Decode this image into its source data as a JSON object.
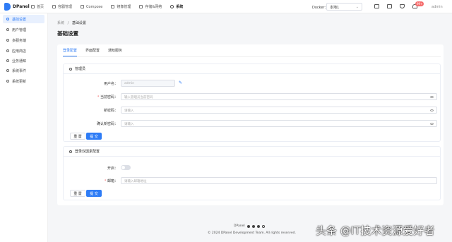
{
  "app": {
    "name": "DPanel"
  },
  "nav": {
    "items": [
      {
        "label": "首页",
        "icon": "home-icon"
      },
      {
        "label": "容器管理",
        "icon": "container-icon"
      },
      {
        "label": "Compose",
        "icon": "compose-icon"
      },
      {
        "label": "镜像管理",
        "icon": "image-icon"
      },
      {
        "label": "存储&网络",
        "icon": "storage-icon"
      },
      {
        "label": "系统",
        "icon": "gear-icon"
      }
    ],
    "active": "系统"
  },
  "docker": {
    "label": "Docker：",
    "value": "本地1"
  },
  "header": {
    "badge": "99+",
    "user": "admin"
  },
  "sidebar": {
    "items": [
      {
        "label": "基础设置"
      },
      {
        "label": "用户管理"
      },
      {
        "label": "多服务端"
      },
      {
        "label": "应用商店"
      },
      {
        "label": "业务通知"
      },
      {
        "label": "系统事件"
      },
      {
        "label": "系统更新"
      }
    ]
  },
  "breadcrumb": {
    "root": "系统",
    "sep": "/",
    "current": "基础设置"
  },
  "page": {
    "title": "基础设置"
  },
  "tabs": [
    {
      "label": "登录配置"
    },
    {
      "label": "界面配置"
    },
    {
      "label": "通知服务"
    }
  ],
  "admin_section": {
    "title": "管理员",
    "username_label": "用户名：",
    "username_value": "admin",
    "current_password_label": "当前密码：",
    "current_password_placeholder": "输入管理员当前密码",
    "new_password_label": "新密码：",
    "new_password_placeholder": "请输入",
    "confirm_password_label": "确认新密码：",
    "confirm_password_placeholder": "请输入",
    "reset_label": "重 置",
    "submit_label": "提 交"
  },
  "twofa_section": {
    "title": "登录双因素配置",
    "enable_label": "开启：",
    "email_label": "邮箱：",
    "email_placeholder": "请输入邮箱地址",
    "reset_label": "重 置",
    "submit_label": "提 交"
  },
  "footer": {
    "brand": "DPanel",
    "copyright": "© 2024 DPanel Development Team. All rights reserved."
  },
  "watermark": "头条 @IT技术资源爱好者",
  "colors": {
    "accent": "#2e7cf6",
    "required": "#f56c6c",
    "badge": "#f56c6c"
  }
}
